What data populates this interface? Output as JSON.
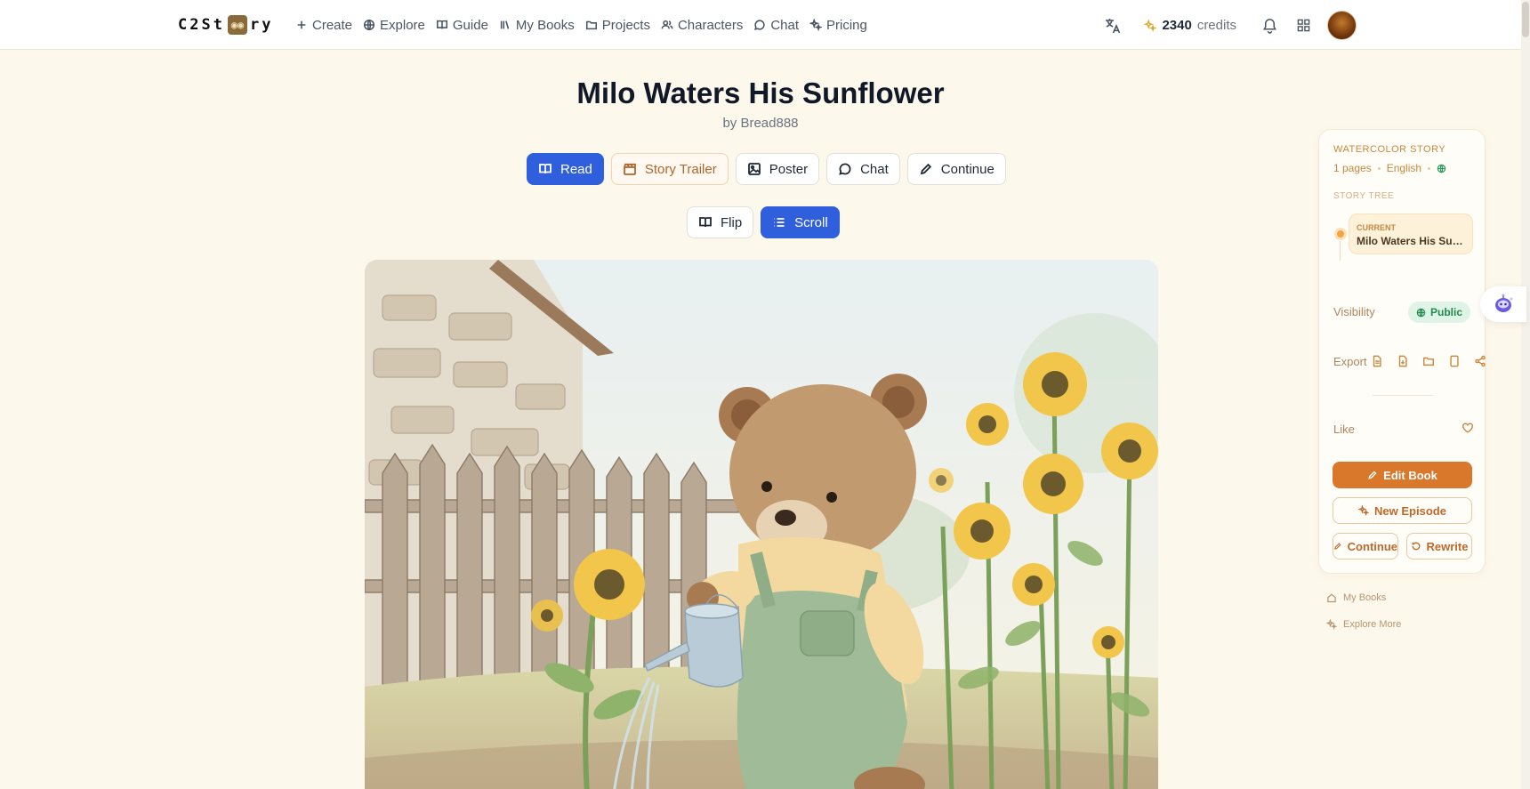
{
  "header": {
    "logo_left": "C2St",
    "logo_right": "ry",
    "nav": [
      {
        "label": "Create",
        "icon": "plus-icon"
      },
      {
        "label": "Explore",
        "icon": "globe-icon"
      },
      {
        "label": "Guide",
        "icon": "book-open-icon"
      },
      {
        "label": "My Books",
        "icon": "library-icon"
      },
      {
        "label": "Projects",
        "icon": "folder-icon"
      },
      {
        "label": "Characters",
        "icon": "users-icon"
      },
      {
        "label": "Chat",
        "icon": "chat-bubble-icon"
      },
      {
        "label": "Pricing",
        "icon": "sparkles-icon"
      }
    ],
    "credits_value": "2340",
    "credits_label": "credits"
  },
  "book": {
    "title": "Milo Waters His Sunflower",
    "byline": "by Bread888"
  },
  "actions": {
    "read": "Read",
    "trailer": "Story Trailer",
    "poster": "Poster",
    "chat": "Chat",
    "continue": "Continue"
  },
  "view_modes": {
    "flip": "Flip",
    "scroll": "Scroll",
    "selected": "Scroll"
  },
  "panel": {
    "style_label": "WATERCOLOR STORY",
    "pages": "1 pages",
    "language": "English",
    "tree_label": "STORY TREE",
    "current_label": "CURRENT",
    "current_title": "Milo Waters His Sunflower",
    "visibility_label": "Visibility",
    "visibility_value": "Public",
    "export_label": "Export",
    "like_label": "Like",
    "edit_book": "Edit Book",
    "new_episode": "New Episode",
    "continue": "Continue",
    "rewrite": "Rewrite"
  },
  "links": {
    "my_books": "My Books",
    "explore_more": "Explore More"
  },
  "colors": {
    "primary_blue": "#2f5fdc",
    "accent_orange": "#d9772b",
    "page_bg": "#fdf8ec"
  }
}
